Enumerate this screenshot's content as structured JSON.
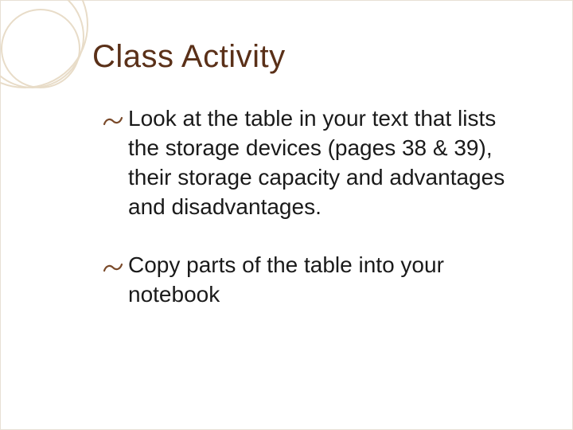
{
  "title": "Class Activity",
  "bullets": [
    {
      "text": "Look at the table in your text that lists the storage devices (pages 38 & 39), their storage capacity and advantages and disadvantages."
    },
    {
      "text": "Copy parts of the table into your notebook"
    }
  ]
}
